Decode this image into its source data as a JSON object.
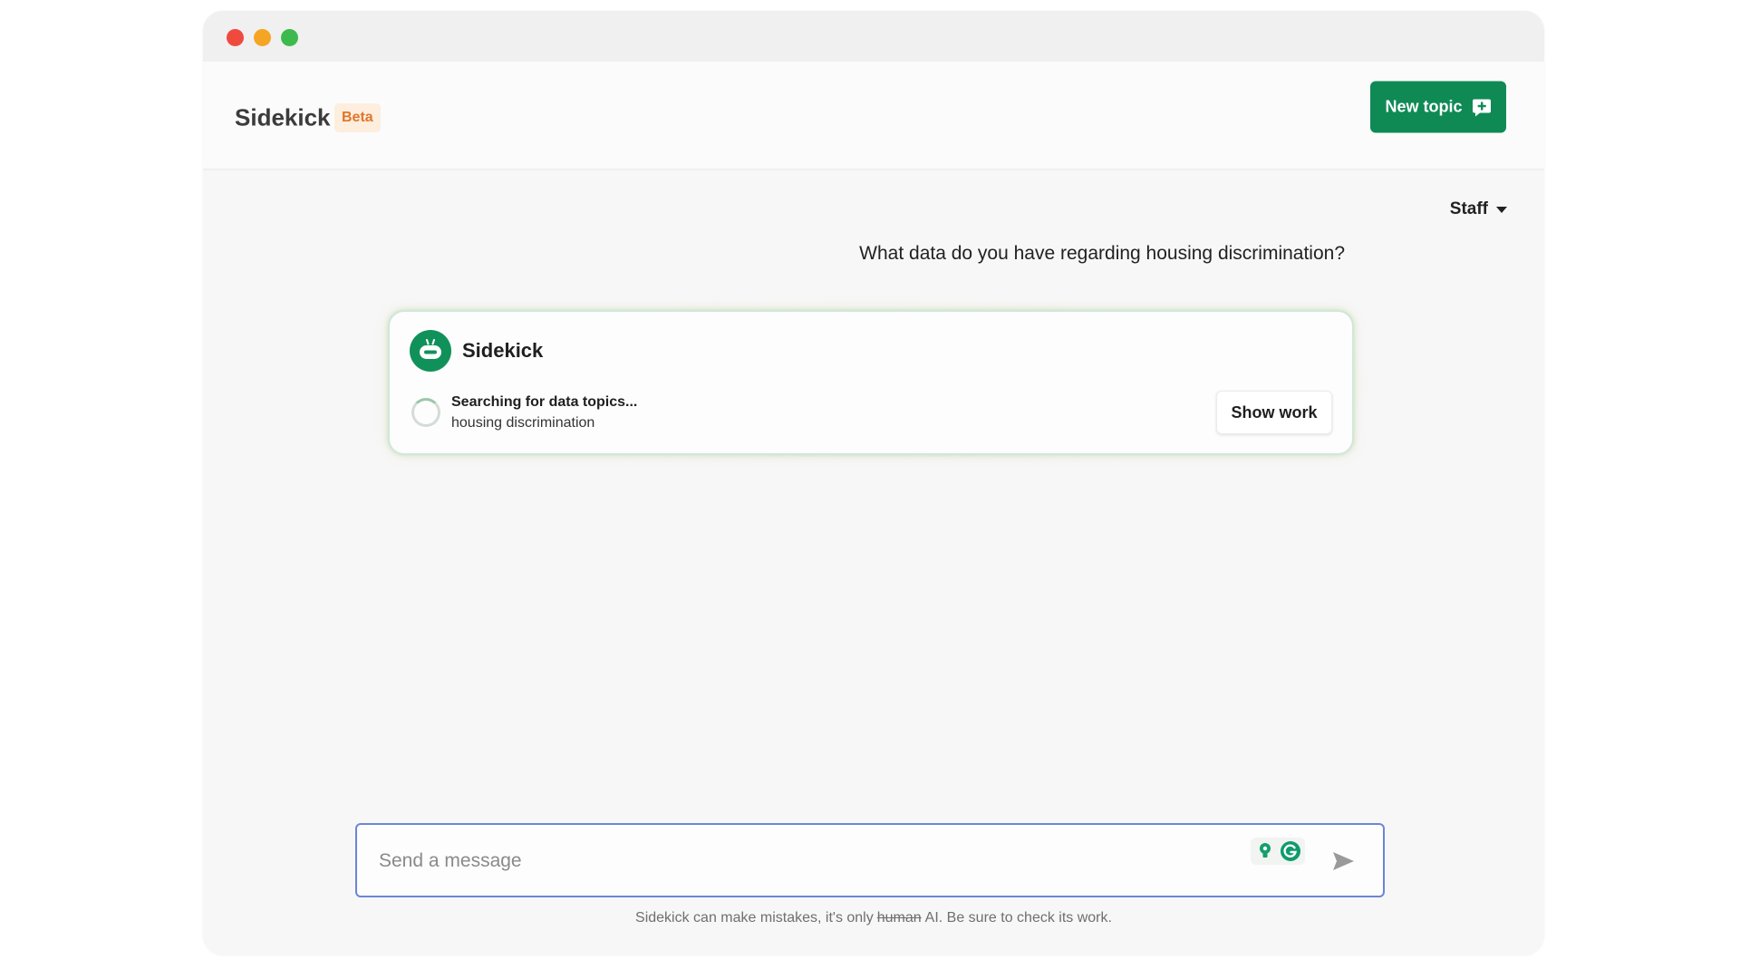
{
  "header": {
    "title": "Sidekick",
    "badge": "Beta",
    "new_topic_label": "New topic"
  },
  "role_selector": {
    "selected": "Staff"
  },
  "conversation": {
    "user_message": "What data do you have regarding housing discrimination?",
    "assistant": {
      "name": "Sidekick",
      "status_title": "Searching for data topics...",
      "status_detail": "housing discrimination",
      "show_work_label": "Show work"
    }
  },
  "composer": {
    "placeholder": "Send a message"
  },
  "disclaimer": {
    "before": "Sidekick can make mistakes, it's only",
    "struck": "human",
    "after": "AI. Be sure to check its work."
  },
  "colors": {
    "brand_green": "#0f8a55",
    "beta_text": "#e0762b",
    "beta_bg": "#fdeede",
    "composer_border": "#6b86d6"
  },
  "icons": {
    "new_topic": "plus-message-icon",
    "role_caret": "caret-down-icon",
    "assistant_avatar": "robot-avatar-icon",
    "loading": "spinner-icon",
    "extension_1": "lightbulb-icon",
    "extension_2": "grammarly-icon",
    "send": "send-icon"
  }
}
